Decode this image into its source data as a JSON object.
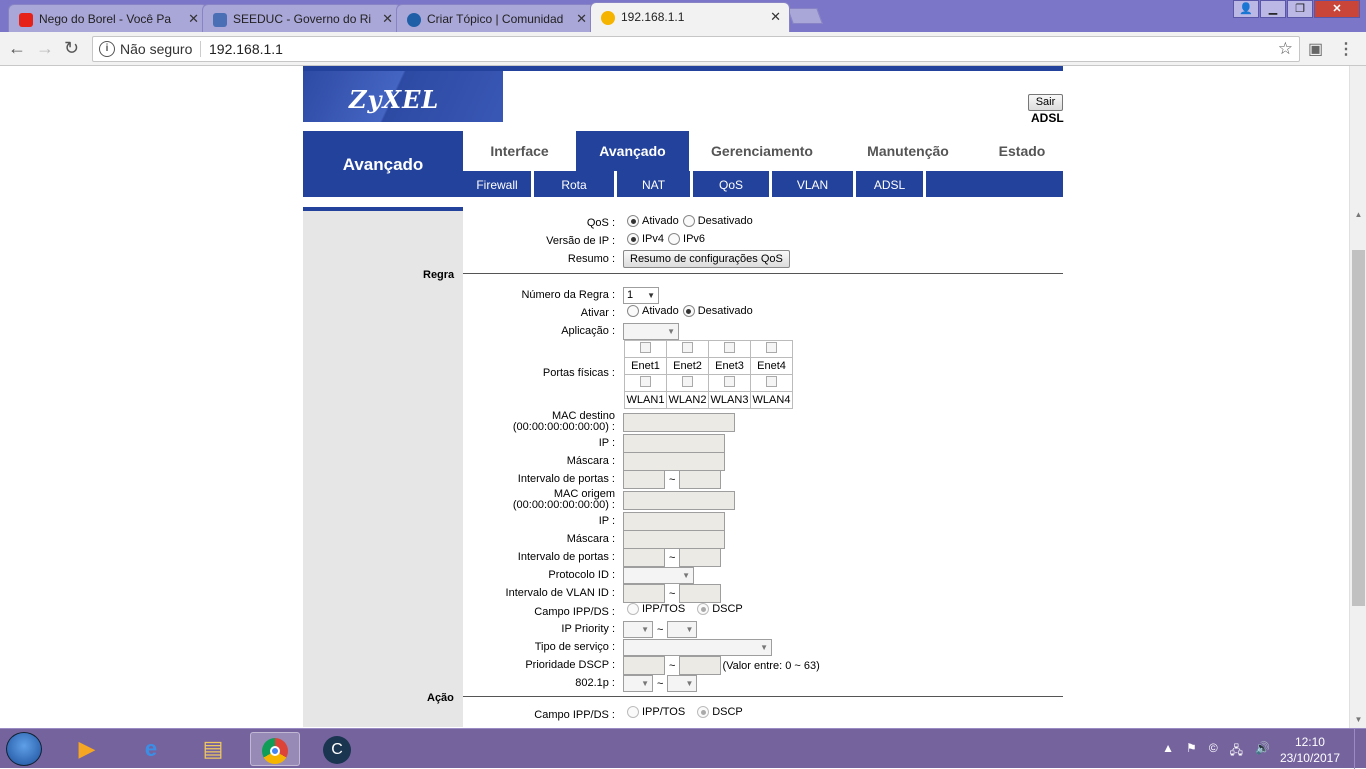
{
  "browser": {
    "tabs": [
      {
        "title": "Nego do Borel - Você Pa",
        "favicon_color": "#e62117"
      },
      {
        "title": "SEEDUC - Governo do Ri",
        "favicon_color": "#4a6fb5"
      },
      {
        "title": "Criar Tópico | Comunidad",
        "favicon_color": "#1f5fa8"
      },
      {
        "title": "192.168.1.1",
        "favicon_color": "#f5b400"
      }
    ],
    "security_label": "Não seguro",
    "url": "192.168.1.1"
  },
  "router": {
    "brand": "ZyXEL",
    "logout_label": "Sair",
    "mode_label": "ADSL",
    "section_title": "Avançado",
    "main_tabs": [
      "Interface",
      "Avançado",
      "Gerenciamento",
      "Manutenção",
      "Estado"
    ],
    "active_main_tab": "Avançado",
    "sub_tabs": [
      "Firewall",
      "Rota",
      "NAT",
      "QoS",
      "VLAN",
      "ADSL"
    ]
  },
  "qos": {
    "qos_label": "QoS :",
    "enabled_label": "Ativado",
    "disabled_label": "Desativado",
    "qos_state": "Ativado",
    "ipver_label": "Versão de IP :",
    "ipv4_label": "IPv4",
    "ipv6_label": "IPv6",
    "ipver_state": "IPv4",
    "summary_label": "Resumo :",
    "summary_button": "Resumo de configurações QoS"
  },
  "rule": {
    "section_label": "Regra",
    "rule_number_label": "Número da Regra :",
    "rule_number_value": "1",
    "activate_label": "Ativar :",
    "activate_state": "Desativado",
    "application_label": "Aplicação :",
    "physical_ports_label": "Portas físicas :",
    "ports_row1": [
      "Enet1",
      "Enet2",
      "Enet3",
      "Enet4"
    ],
    "ports_row2": [
      "WLAN1",
      "WLAN2",
      "WLAN3",
      "WLAN4"
    ],
    "dest_mac_label": "MAC destino",
    "dest_mac_format": "(00:00:00:00:00:00) :",
    "ip_label": "IP :",
    "mask_label": "Máscara :",
    "port_range_label": "Intervalo de portas :",
    "src_mac_label": "MAC origem",
    "src_mac_format": "(00:00:00:00:00:00) :",
    "protocol_label": "Protocolo ID :",
    "vlan_range_label": "Intervalo de VLAN ID :",
    "ippds_label": "Campo IPP/DS :",
    "ipptos_label": "IPP/TOS",
    "dscp_label": "DSCP",
    "ip_priority_label": "IP Priority :",
    "service_type_label": "Tipo de serviço :",
    "dscp_priority_label": "Prioridade DSCP :",
    "dscp_range_note": "(Valor entre: 0 ~ 63)",
    "dot1p_label": "802.1p :",
    "tilde": "~"
  },
  "action": {
    "section_label": "Ação",
    "ippds_label": "Campo IPP/DS :",
    "ipptos_label": "IPP/TOS",
    "dscp_label": "DSCP"
  },
  "taskbar": {
    "time": "12:10",
    "date": "23/10/2017"
  }
}
